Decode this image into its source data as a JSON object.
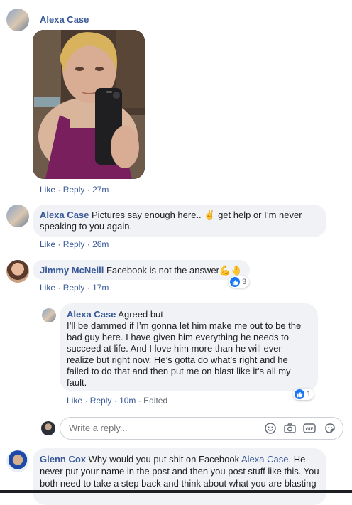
{
  "comments": [
    {
      "author": "Alexa Case",
      "text": "",
      "actions": {
        "like": "Like",
        "reply": "Reply",
        "time": "27m"
      }
    },
    {
      "author": "Alexa Case",
      "text_line1": "Pictures say enough here.. ✌ get help or I’m never",
      "text_line2": "speaking to you again.",
      "actions": {
        "like": "Like",
        "reply": "Reply",
        "time": "26m"
      }
    },
    {
      "author": "Jimmy McNeill",
      "text": "Facebook is not the answer💪🤚",
      "reaction_count": "3",
      "actions": {
        "like": "Like",
        "reply": "Reply",
        "time": "17m"
      }
    }
  ],
  "reply": {
    "author": "Alexa Case",
    "first_line": "Agreed but",
    "lines": [
      "I’ll be dammed if I’m gonna let him make me out to be the",
      "bad guy here. I have given him everything he needs to",
      "succeed at life. And I love him more than he will ever",
      "realize but right now. He’s gotta do what’s right and he",
      "failed to do that and then put me on blast like it’s all my",
      "fault."
    ],
    "reaction_count": "1",
    "actions": {
      "like": "Like",
      "reply": "Reply",
      "time": "10m",
      "edited": "Edited"
    }
  },
  "reply_box": {
    "placeholder": "Write a reply..."
  },
  "last_comment": {
    "author": "Glenn Cox",
    "text_start": "Why would you put shit on Facebook",
    "mention": "Alexa Case",
    "text_end": ". He",
    "line2": "never put your name in the post and then you post stuff like this. You",
    "line3": "both need to take a step back and think about what you are blasting"
  },
  "colors": {
    "link": "#385898",
    "bubble": "#f0f2f5",
    "like_blue": "#1877f2"
  }
}
